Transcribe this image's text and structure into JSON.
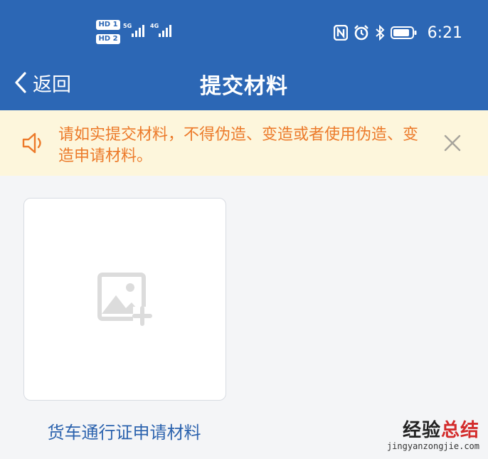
{
  "status_bar": {
    "sim1_badge": "HD 1",
    "sim2_badge": "HD 2",
    "net1": "5G",
    "net2": "4G",
    "time": "6:21",
    "icons": [
      "nfc-icon",
      "alarm-icon",
      "bluetooth-icon",
      "battery-icon"
    ]
  },
  "nav": {
    "back_label": "返回",
    "title": "提交材料"
  },
  "notice": {
    "text": "请如实提交材料，不得伪造、变造或者使用伪造、变造申请材料。",
    "icon": "speaker-icon",
    "close_icon": "close-icon"
  },
  "upload_card": {
    "icon": "add-image-icon",
    "label": "货车通行证申请材料"
  },
  "watermark": {
    "main_prefix": "经验",
    "main_suffix": "总结",
    "sub": "jingyanzongjie.com"
  },
  "colors": {
    "header": "#2c67b5",
    "notice_bg": "#fdf6dc",
    "notice_text": "#ec7a2a",
    "link": "#2c63ae",
    "page_bg": "#f4f5f7"
  }
}
